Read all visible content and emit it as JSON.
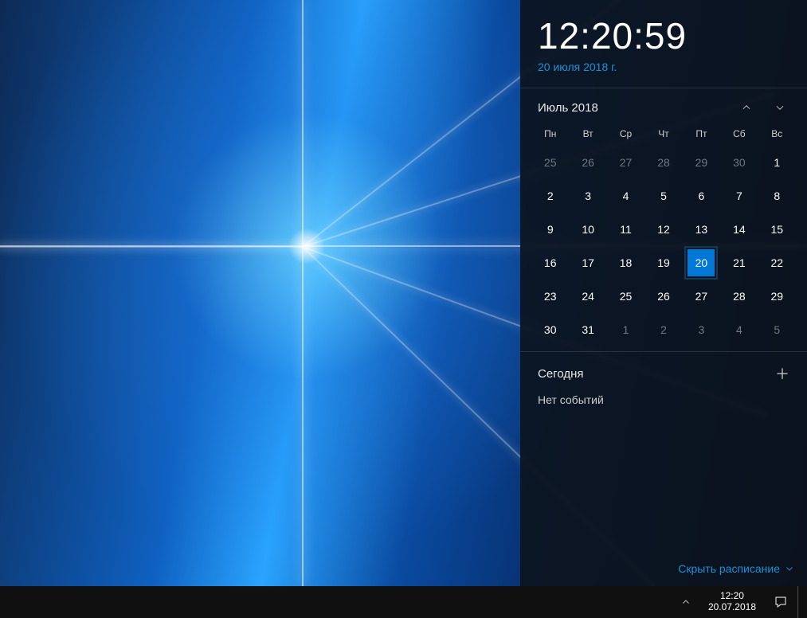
{
  "clock": {
    "time": "12:20:59",
    "date_long": "20 июля 2018 г."
  },
  "calendar": {
    "month_label": "Июль 2018",
    "dow": [
      "Пн",
      "Вт",
      "Ср",
      "Чт",
      "Пт",
      "Сб",
      "Вс"
    ],
    "weeks": [
      [
        {
          "d": "25",
          "other": true
        },
        {
          "d": "26",
          "other": true
        },
        {
          "d": "27",
          "other": true
        },
        {
          "d": "28",
          "other": true
        },
        {
          "d": "29",
          "other": true
        },
        {
          "d": "30",
          "other": true
        },
        {
          "d": "1"
        }
      ],
      [
        {
          "d": "2"
        },
        {
          "d": "3"
        },
        {
          "d": "4"
        },
        {
          "d": "5"
        },
        {
          "d": "6"
        },
        {
          "d": "7"
        },
        {
          "d": "8"
        }
      ],
      [
        {
          "d": "9"
        },
        {
          "d": "10"
        },
        {
          "d": "11"
        },
        {
          "d": "12"
        },
        {
          "d": "13"
        },
        {
          "d": "14"
        },
        {
          "d": "15"
        }
      ],
      [
        {
          "d": "16"
        },
        {
          "d": "17"
        },
        {
          "d": "18"
        },
        {
          "d": "19"
        },
        {
          "d": "20",
          "today": true
        },
        {
          "d": "21"
        },
        {
          "d": "22"
        }
      ],
      [
        {
          "d": "23"
        },
        {
          "d": "24"
        },
        {
          "d": "25"
        },
        {
          "d": "26"
        },
        {
          "d": "27"
        },
        {
          "d": "28"
        },
        {
          "d": "29"
        }
      ],
      [
        {
          "d": "30"
        },
        {
          "d": "31"
        },
        {
          "d": "1",
          "other": true
        },
        {
          "d": "2",
          "other": true
        },
        {
          "d": "3",
          "other": true
        },
        {
          "d": "4",
          "other": true
        },
        {
          "d": "5",
          "other": true
        }
      ]
    ]
  },
  "agenda": {
    "title": "Сегодня",
    "empty_text": "Нет событий"
  },
  "hide_schedule_label": "Скрыть расписание",
  "taskbar": {
    "time": "12:20",
    "date": "20.07.2018"
  }
}
